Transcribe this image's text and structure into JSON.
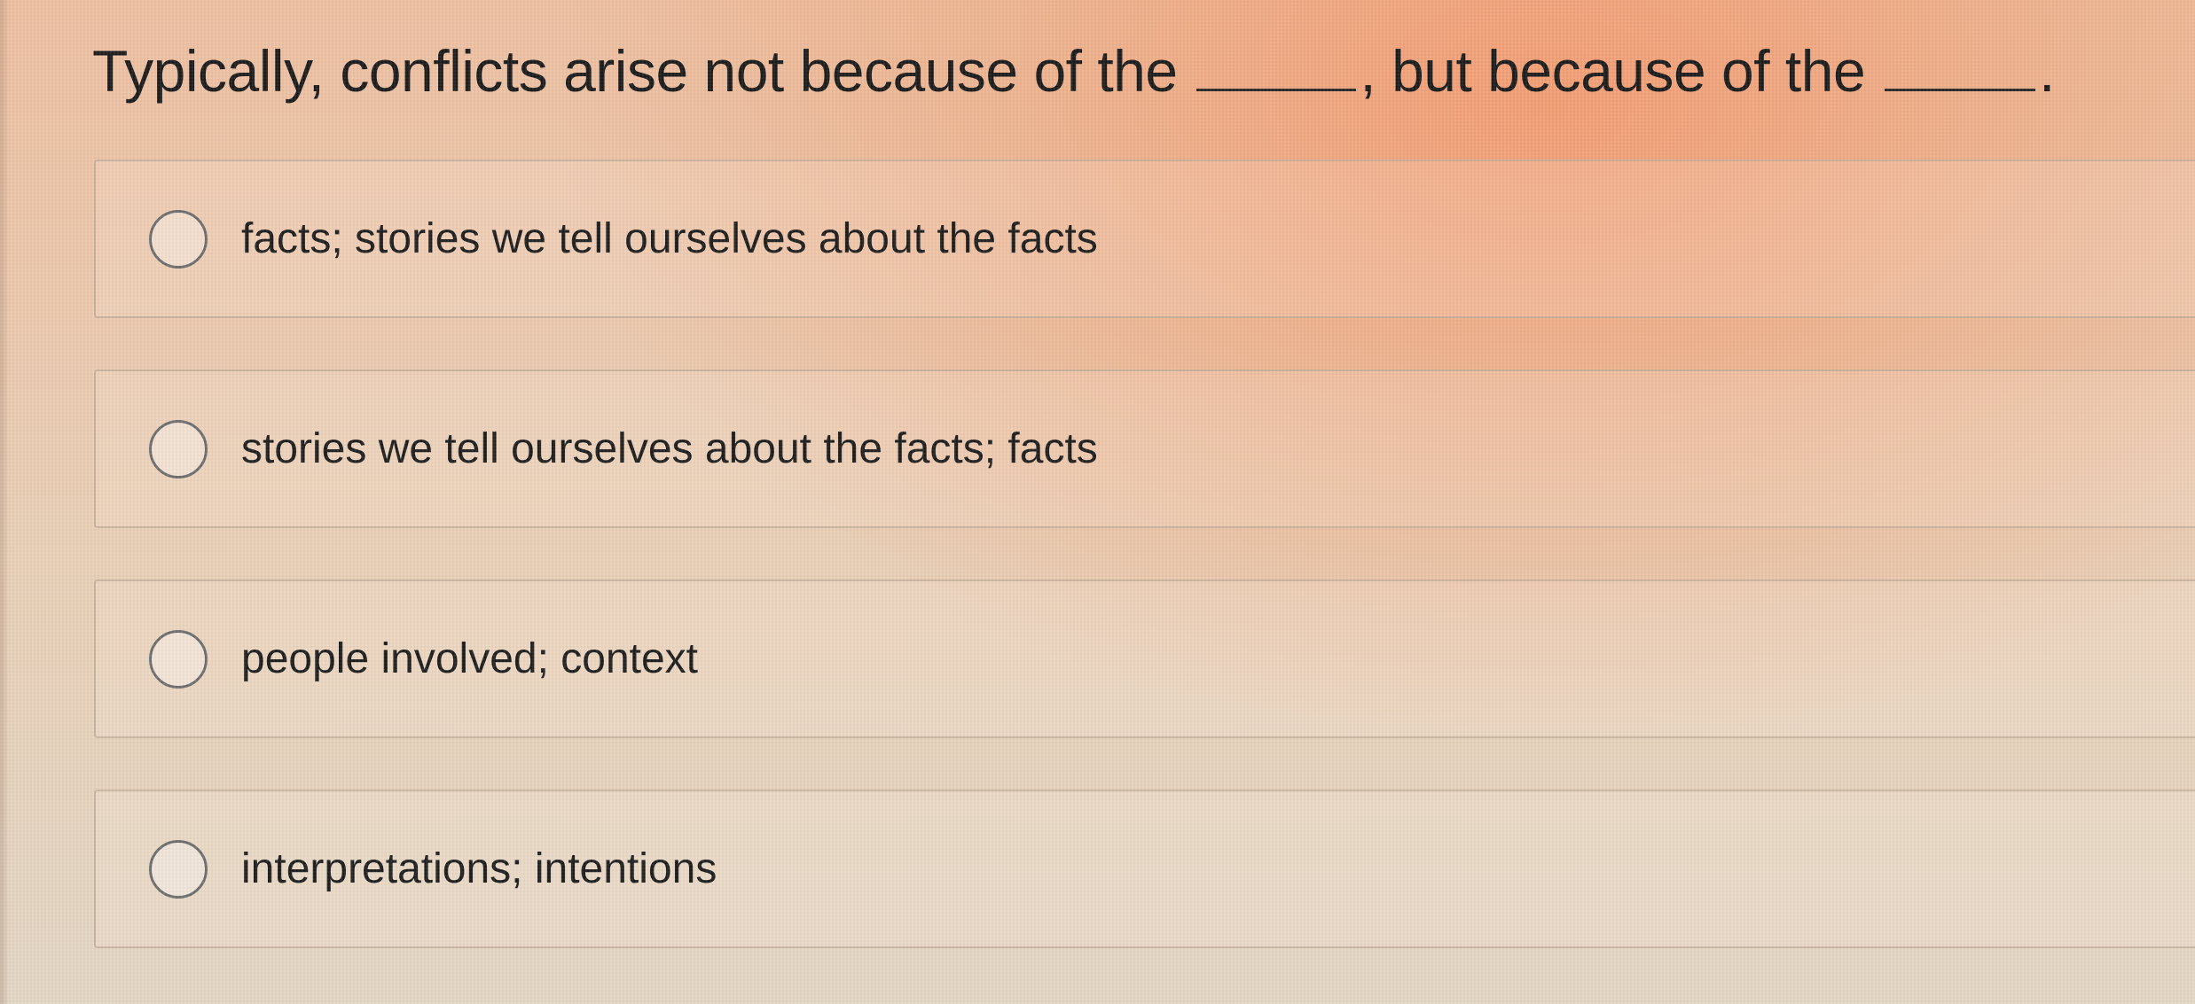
{
  "question": {
    "part1": "Typically, conflicts arise not because of the",
    "part2": ", but because of the",
    "part3": "."
  },
  "options": [
    {
      "label": "facts; stories we tell ourselves about the facts",
      "selected": false
    },
    {
      "label": "stories we tell ourselves about the facts; facts",
      "selected": false
    },
    {
      "label": "people involved; context",
      "selected": false
    },
    {
      "label": "interpretations; intentions",
      "selected": false
    }
  ]
}
